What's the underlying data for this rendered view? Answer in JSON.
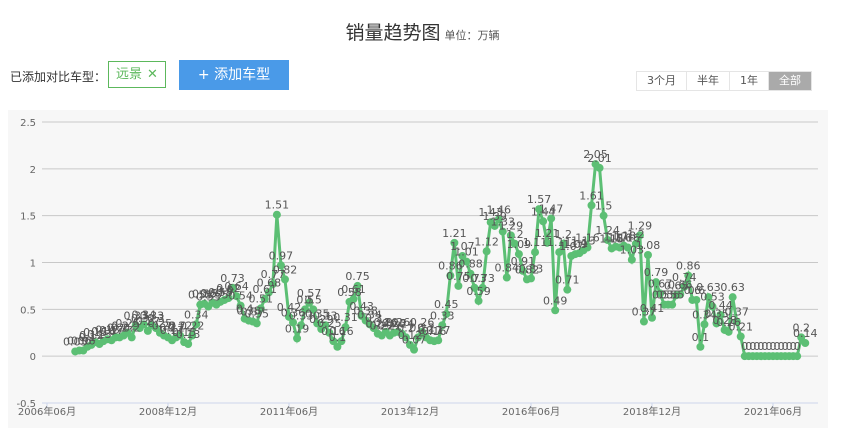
{
  "header": {
    "title": "销量趋势图",
    "unit": "单位：万辆"
  },
  "compare": {
    "label": "已添加对比车型：",
    "tags": [
      {
        "name": "远景",
        "remove_icon": "✕"
      }
    ],
    "add_button": "+ 添加车型"
  },
  "range_buttons": [
    {
      "label": "3个月",
      "active": false
    },
    {
      "label": "半年",
      "active": false
    },
    {
      "label": "1年",
      "active": false
    },
    {
      "label": "全部",
      "active": true
    }
  ],
  "colors": {
    "line": "#5cbf74",
    "accent": "#4a9ae8",
    "label": "#555555"
  },
  "chart_data": {
    "type": "line",
    "title": "销量趋势图",
    "ylabel": "万辆",
    "xlabel": "",
    "ylim": [
      -0.5,
      2.5
    ],
    "yticks": [
      2.5,
      2,
      1.5,
      1,
      0.5,
      0,
      -0.5
    ],
    "xticks": [
      "2006年06月",
      "2008年12月",
      "2011年06月",
      "2013年12月",
      "2016年06月",
      "2018年12月",
      "2021年06月"
    ],
    "x_start": "2007-01",
    "x_axis_start": "2006-06",
    "x_tick_interval_months": 30,
    "series": [
      {
        "name": "远景",
        "values": [
          0.05,
          0.06,
          0.06,
          0.1,
          0.12,
          0.15,
          0.13,
          0.16,
          0.18,
          0.17,
          0.2,
          0.2,
          0.22,
          0.25,
          0.2,
          0.33,
          0.3,
          0.34,
          0.27,
          0.33,
          0.3,
          0.25,
          0.22,
          0.2,
          0.17,
          0.2,
          0.22,
          0.15,
          0.13,
          0.22,
          0.34,
          0.55,
          0.56,
          0.53,
          0.57,
          0.55,
          0.58,
          0.6,
          0.62,
          0.73,
          0.64,
          0.54,
          0.4,
          0.38,
          0.37,
          0.35,
          0.51,
          0.61,
          0.68,
          0.77,
          1.51,
          0.97,
          0.82,
          0.42,
          0.36,
          0.19,
          0.33,
          0.5,
          0.57,
          0.5,
          0.35,
          0.29,
          0.33,
          0.25,
          0.16,
          0.1,
          0.16,
          0.31,
          0.58,
          0.61,
          0.75,
          0.43,
          0.38,
          0.34,
          0.3,
          0.24,
          0.22,
          0.26,
          0.22,
          0.25,
          0.26,
          0.24,
          0.2,
          0.12,
          0.07,
          0.2,
          0.26,
          0.2,
          0.17,
          0.16,
          0.17,
          0.33,
          0.45,
          0.86,
          1.21,
          0.75,
          1.07,
          1.01,
          0.88,
          0.73,
          0.59,
          0.73,
          1.12,
          1.43,
          1.39,
          1.46,
          1.33,
          0.84,
          1.29,
          1.2,
          1.09,
          0.91,
          0.82,
          0.83,
          1.11,
          1.57,
          1.44,
          1.21,
          1.47,
          0.49,
          1.11,
          1.2,
          0.71,
          1.07,
          1.09,
          1.1,
          1.13,
          1.16,
          1.61,
          2.05,
          2.01,
          1.5,
          1.24,
          1.15,
          1.17,
          1.16,
          1.18,
          1.16,
          1.03,
          1.2,
          1.29,
          0.37,
          1.08,
          0.41,
          0.79,
          0.67,
          0.55,
          0.55,
          0.55,
          0.65,
          0.66,
          0.74,
          0.86,
          0.6,
          0.6,
          0.1,
          0.34,
          0.63,
          0.53,
          0.35,
          0.44,
          0.28,
          0.26,
          0.63,
          0.37,
          0.21,
          0,
          0,
          0,
          0,
          0,
          0,
          0,
          0,
          0,
          0,
          0,
          0,
          0,
          0,
          0.2,
          0.14
        ]
      }
    ],
    "grid": true,
    "legend": "none",
    "data_labels": true
  }
}
